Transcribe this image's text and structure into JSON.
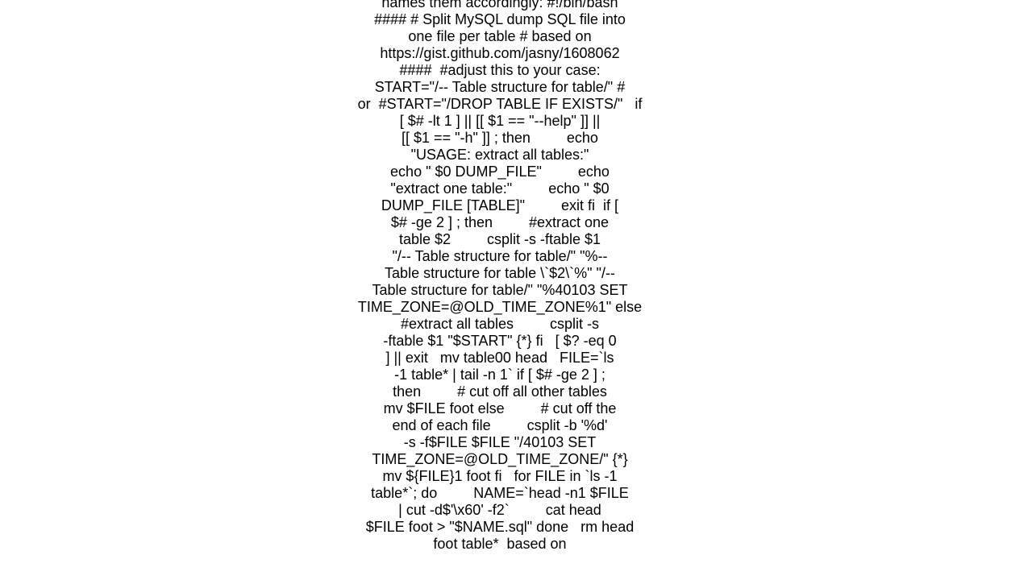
{
  "document": {
    "lines": [
      "names them accordingly: #!/bin/bash",
      "#### # Split MySQL dump SQL file into",
      "one file per table # based on",
      "https://gist.github.com/jasny/1608062",
      "####  #adjust this to your case:",
      "START=\"/-- Table structure for table/\" #",
      "or  #START=\"/DROP TABLE IF EXISTS/\"   if",
      "[ $# -lt 1 ] || [[ $1 == \"--help\" ]] ||",
      "[[ $1 == \"-h\" ]] ; then         echo",
      "\"USAGE: extract all tables:\"",
      "echo \" $0 DUMP_FILE\"         echo",
      "\"extract one table:\"         echo \" $0",
      "DUMP_FILE [TABLE]\"         exit fi  if [",
      "$# -ge 2 ] ; then         #extract one",
      "table $2         csplit -s -ftable $1",
      "\"/-- Table structure for table/\" \"%--",
      "Table structure for table \\`$2\\`%\" \"/--",
      "Table structure for table/\" \"%40103 SET",
      "TIME_ZONE=@OLD_TIME_ZONE%1\" else",
      "#extract all tables         csplit -s",
      "-ftable $1 \"$START\" {*} fi   [ $? -eq 0",
      "] || exit   mv table00 head   FILE=`ls",
      "-1 table* | tail -n 1` if [ $# -ge 2 ] ;",
      "then         # cut off all other tables",
      "mv $FILE foot else         # cut off the",
      "end of each file         csplit -b '%d'",
      "-s -f$FILE $FILE \"/40103 SET",
      "TIME_ZONE=@OLD_TIME_ZONE/\" {*}",
      "mv ${FILE}1 foot fi   for FILE in `ls -1",
      "table*`; do         NAME=`head -n1 $FILE",
      "| cut -d$'\\x60' -f2`         cat head",
      "$FILE foot > \"$NAME.sql\" done   rm head",
      "foot table*  based on"
    ]
  }
}
